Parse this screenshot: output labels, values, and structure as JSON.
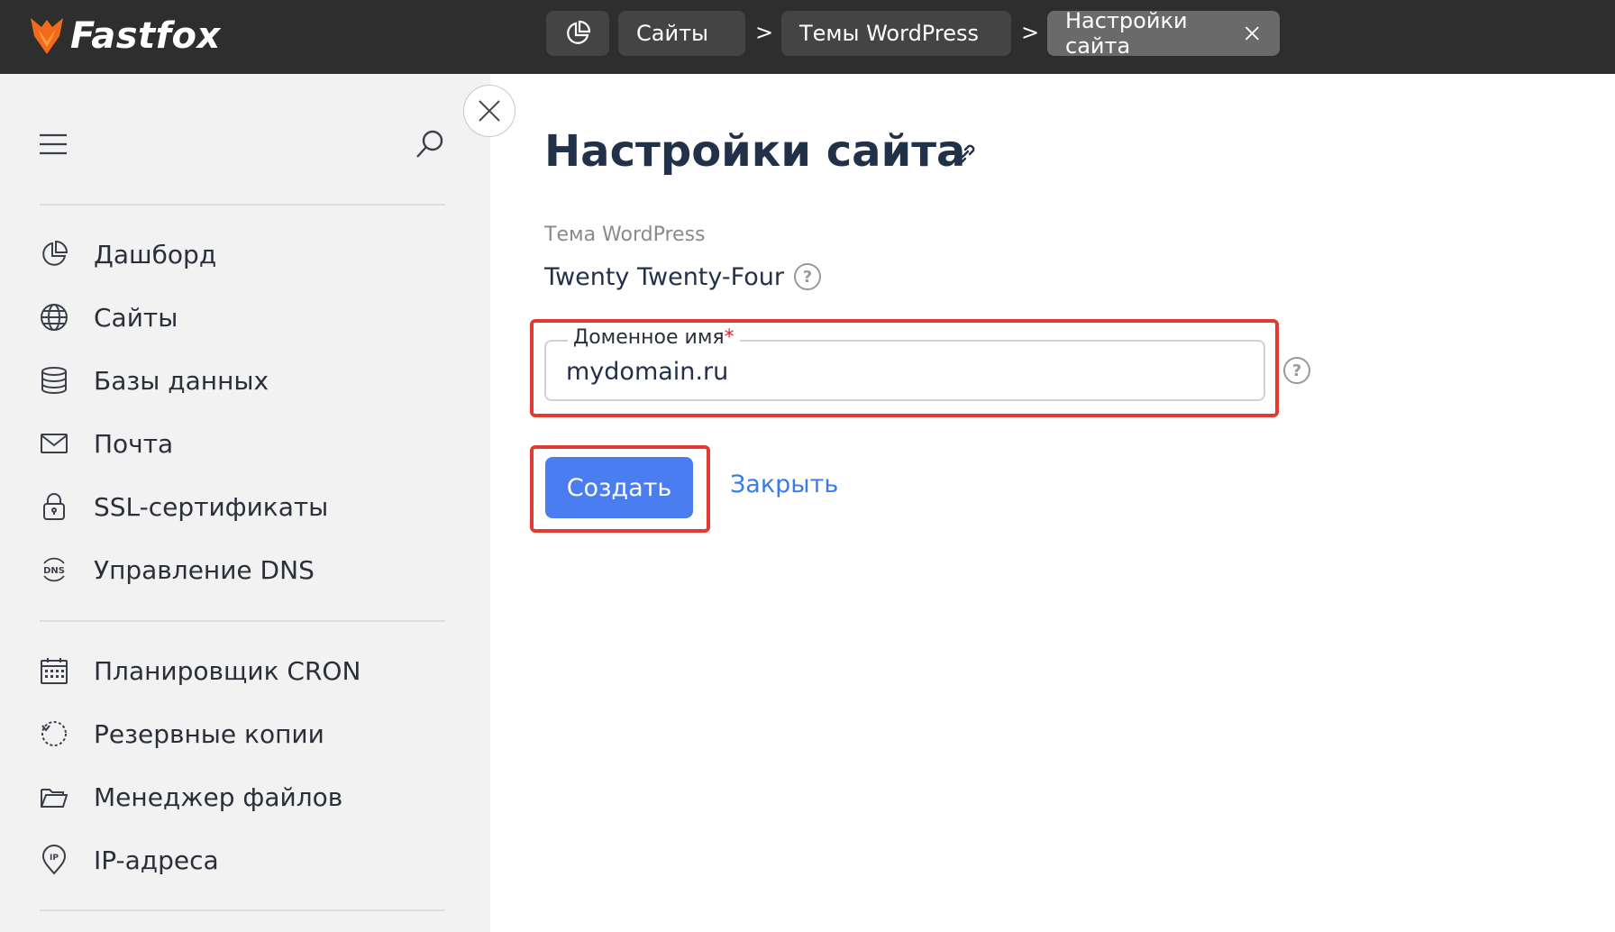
{
  "app": {
    "logo_text": "Fastfox"
  },
  "breadcrumbs": [
    {
      "label": ""
    },
    {
      "label": "Сайты"
    },
    {
      "label": "Темы WordPress"
    },
    {
      "label": "Настройки сайта"
    }
  ],
  "breadcrumb_separator": ">",
  "sidebar": {
    "items": [
      {
        "label": "Дашборд",
        "icon": "pie-chart-icon"
      },
      {
        "label": "Сайты",
        "icon": "globe-icon"
      },
      {
        "label": "Базы данных",
        "icon": "database-icon"
      },
      {
        "label": "Почта",
        "icon": "mail-icon"
      },
      {
        "label": "SSL-сертификаты",
        "icon": "lock-icon"
      },
      {
        "label": "Управление DNS",
        "icon": "dns-icon"
      },
      {
        "label": "Планировщик CRON",
        "icon": "calendar-icon"
      },
      {
        "label": "Резервные копии",
        "icon": "backup-icon"
      },
      {
        "label": "Менеджер файлов",
        "icon": "folder-icon"
      },
      {
        "label": "IP-адреса",
        "icon": "ip-pin-icon"
      }
    ]
  },
  "main": {
    "title": "Настройки сайта",
    "theme_label": "Тема WordPress",
    "theme_value": "Twenty Twenty-Four",
    "domain_field": {
      "label": "Доменное имя",
      "required_mark": "*",
      "value": "mydomain.ru"
    },
    "create_label": "Создать",
    "close_label": "Закрыть",
    "help_mark": "?"
  },
  "colors": {
    "topbar": "#2e2e2e",
    "accent": "#4a7ef0",
    "highlight": "#e03a33",
    "logo_orange": "#f26a1b"
  }
}
